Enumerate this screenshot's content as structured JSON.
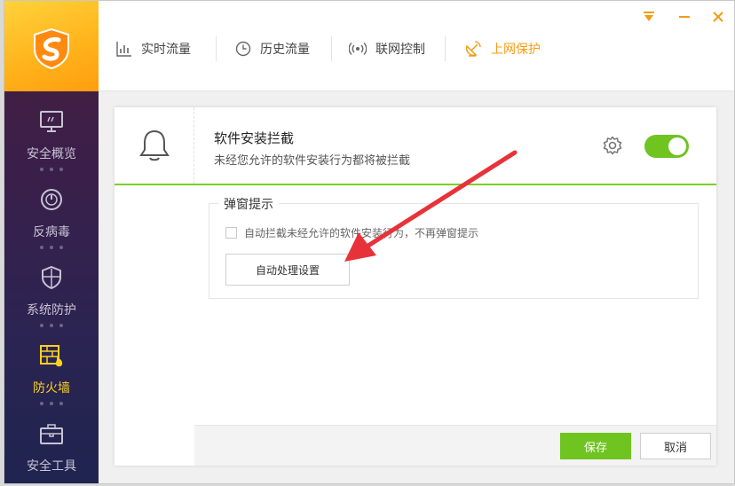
{
  "sidebar": {
    "items": [
      {
        "label": "安全概览",
        "icon": "monitor-icon"
      },
      {
        "label": "反病毒",
        "icon": "speedometer-icon"
      },
      {
        "label": "系统防护",
        "icon": "shield-icon"
      },
      {
        "label": "防火墙",
        "icon": "firewall-icon",
        "active": true
      },
      {
        "label": "安全工具",
        "icon": "toolbox-icon"
      }
    ]
  },
  "tabs": [
    {
      "label": "实时流量",
      "icon": "bar-chart-icon"
    },
    {
      "label": "历史流量",
      "icon": "clock-icon"
    },
    {
      "label": "联网控制",
      "icon": "radio-icon"
    },
    {
      "label": "上网保护",
      "icon": "satellite-icon",
      "active": true
    }
  ],
  "card": {
    "title": "软件安装拦截",
    "subtitle": "未经您允许的软件安装行为都将被拦截",
    "toggle_on": true
  },
  "popup_section": {
    "legend": "弹窗提示",
    "checkbox_label": "自动拦截未经允许的软件安装行为，不再弹窗提示",
    "checkbox_checked": false,
    "auto_button": "自动处理设置"
  },
  "footer": {
    "save": "保存",
    "cancel": "取消"
  },
  "colors": {
    "accent_green": "#6fc420",
    "accent_orange": "#f59b12",
    "active_nav": "#ffd21f",
    "arrow_red": "#e8323a"
  }
}
